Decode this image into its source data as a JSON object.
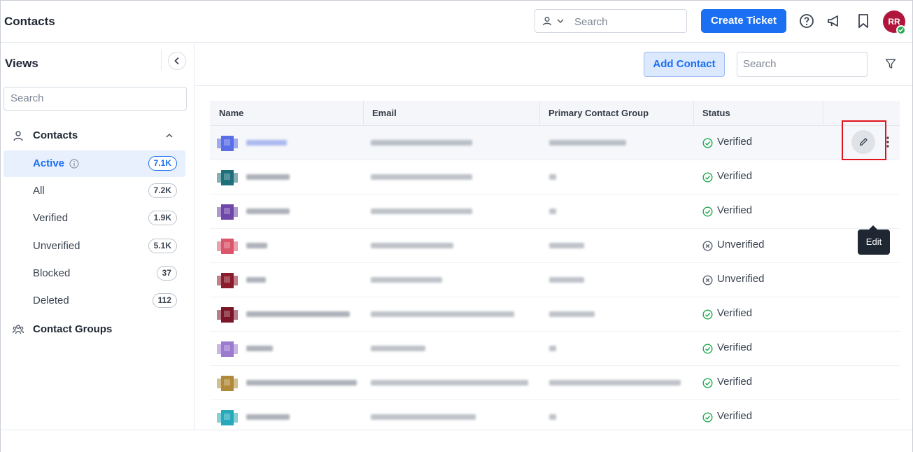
{
  "header": {
    "title": "Contacts",
    "search_placeholder": "Search",
    "create_ticket_label": "Create Ticket",
    "avatar_initials": "RR"
  },
  "sidebar": {
    "title": "Views",
    "search_placeholder": "Search",
    "contacts_group_label": "Contacts",
    "contact_groups_label": "Contact Groups",
    "items": [
      {
        "label": "Active",
        "count": "7.1K"
      },
      {
        "label": "All",
        "count": "7.2K"
      },
      {
        "label": "Verified",
        "count": "1.9K"
      },
      {
        "label": "Unverified",
        "count": "5.1K"
      },
      {
        "label": "Blocked",
        "count": "37"
      },
      {
        "label": "Deleted",
        "count": "112"
      }
    ]
  },
  "main": {
    "add_contact_label": "Add Contact",
    "search_placeholder": "Search",
    "columns": {
      "name": "Name",
      "email": "Email",
      "group": "Primary Contact Group",
      "status": "Status"
    },
    "rows": [
      {
        "status": "Verified",
        "avatar_color": "#5a6ee6"
      },
      {
        "status": "Verified",
        "avatar_color": "#1f6f7a"
      },
      {
        "status": "Verified",
        "avatar_color": "#6e47a8"
      },
      {
        "status": "Unverified",
        "avatar_color": "#d9566b"
      },
      {
        "status": "Unverified",
        "avatar_color": "#8a1c2c"
      },
      {
        "status": "Verified",
        "avatar_color": "#7a1628"
      },
      {
        "status": "Verified",
        "avatar_color": "#9b7ad0"
      },
      {
        "status": "Verified",
        "avatar_color": "#b08a3a"
      },
      {
        "status": "Verified",
        "avatar_color": "#28a8b8"
      }
    ],
    "tooltip": "Edit"
  },
  "colors": {
    "accent": "#1a6ff2",
    "verified": "#23a84f",
    "highlight": "#e0141e"
  }
}
